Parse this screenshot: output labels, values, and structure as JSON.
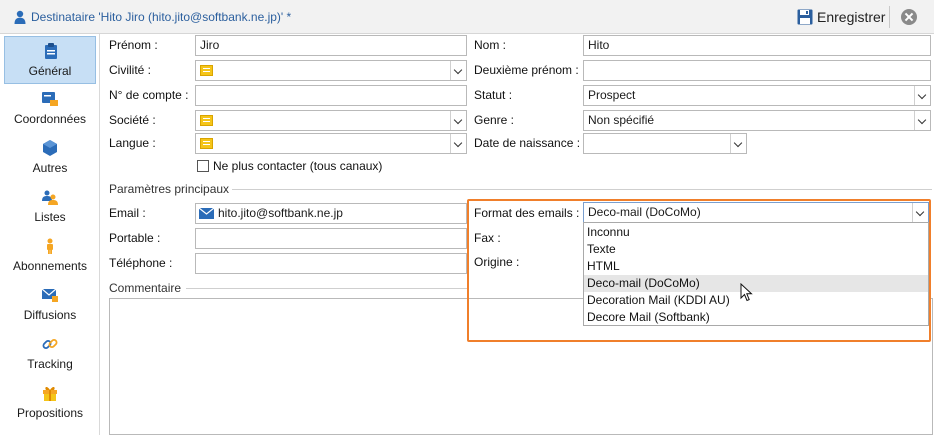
{
  "window": {
    "title": "Destinataire 'Hito Jiro (hito.jito@softbank.ne.jp)' *"
  },
  "toolbar": {
    "save_label": "Enregistrer"
  },
  "sidebar": {
    "items": [
      {
        "label": "Général",
        "icon": "clipboard-icon",
        "active": true
      },
      {
        "label": "Coordonnées",
        "icon": "contact-card-icon"
      },
      {
        "label": "Autres",
        "icon": "cube-icon"
      },
      {
        "label": "Listes",
        "icon": "group-icon"
      },
      {
        "label": "Abonnements",
        "icon": "person-icon"
      },
      {
        "label": "Diffusions",
        "icon": "mail-icon"
      },
      {
        "label": "Tracking",
        "icon": "link-icon"
      },
      {
        "label": "Propositions",
        "icon": "gift-icon"
      }
    ]
  },
  "form": {
    "prenom": {
      "label": "Prénom :",
      "value": "Jiro"
    },
    "nom": {
      "label": "Nom :",
      "value": "Hito"
    },
    "civilite": {
      "label": "Civilité :",
      "value": ""
    },
    "deuxieme_prenom": {
      "label": "Deuxième prénom :",
      "value": ""
    },
    "compte": {
      "label": "N° de compte :",
      "value": ""
    },
    "statut": {
      "label": "Statut :",
      "value": "Prospect"
    },
    "societe": {
      "label": "Société :",
      "value": ""
    },
    "genre": {
      "label": "Genre :",
      "value": "Non spécifié"
    },
    "langue": {
      "label": "Langue :",
      "value": ""
    },
    "naissance": {
      "label": "Date de naissance :",
      "value": ""
    },
    "ne_plus_contacter": {
      "label": "Ne plus contacter (tous canaux)",
      "checked": false
    }
  },
  "params": {
    "title": "Paramètres principaux",
    "email": {
      "label": "Email :",
      "value": "hito.jito@softbank.ne.jp"
    },
    "portable": {
      "label": "Portable :",
      "value": ""
    },
    "telephone": {
      "label": "Téléphone :",
      "value": ""
    },
    "format": {
      "label": "Format des emails :",
      "value": "Deco-mail (DoCoMo)",
      "options": [
        "Inconnu",
        "Texte",
        "HTML",
        "Deco-mail (DoCoMo)",
        "Decoration Mail (KDDI AU)",
        "Decore Mail (Softbank)"
      ],
      "hovered": "Deco-mail (DoCoMo)"
    },
    "fax": {
      "label": "Fax :"
    },
    "origine": {
      "label": "Origine :"
    }
  },
  "comment": {
    "label": "Commentaire"
  },
  "colors": {
    "accent": "#2b5f9e",
    "highlight": "#f07f2b",
    "active_nav": "#c7dff5"
  }
}
